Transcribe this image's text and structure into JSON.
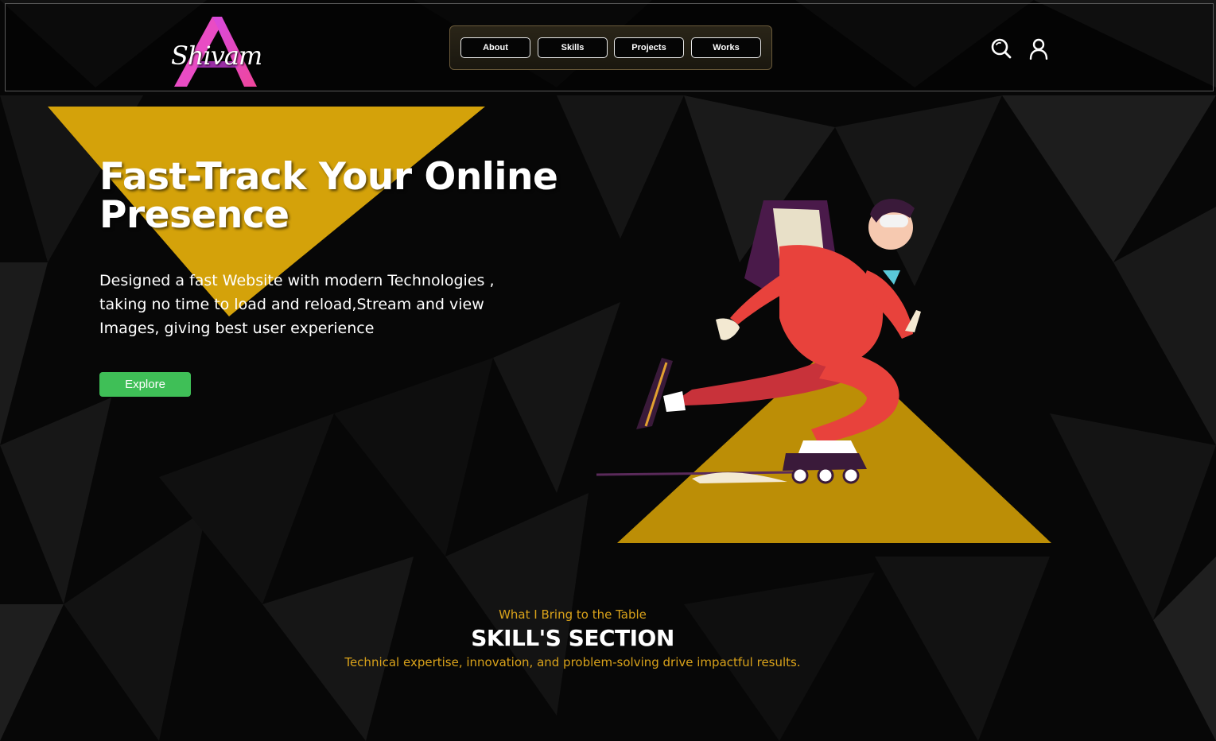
{
  "brand": {
    "logo_text": "Shivam",
    "logo_icon": "letter-a-logo"
  },
  "nav": {
    "items": [
      {
        "label": "About"
      },
      {
        "label": "Skills"
      },
      {
        "label": "Projects"
      },
      {
        "label": "Works"
      }
    ]
  },
  "header_icons": {
    "search": "search-icon",
    "user": "user-icon"
  },
  "hero": {
    "title_line1": "Fast-Track Your Online",
    "title_line2": "Presence",
    "description": "Designed a fast Website with modern Technologies , taking no time to load and reload,Stream and view Images, giving best user experience",
    "cta_label": "Explore",
    "illustration": "skater-with-backpack-illustration"
  },
  "skills": {
    "eyebrow": "What I Bring to the Table",
    "title": "SKILL'S SECTION",
    "subtitle": "Technical expertise, innovation, and problem-solving drive impactful results."
  },
  "colors": {
    "background": "#080808",
    "accent_gold": "#d4a20a",
    "accent_text_gold": "#d9a21a",
    "cta_green": "#3fbf57",
    "logo_pink": "#e0409a",
    "logo_purple": "#b03cd8",
    "runner_red": "#e8423c"
  }
}
